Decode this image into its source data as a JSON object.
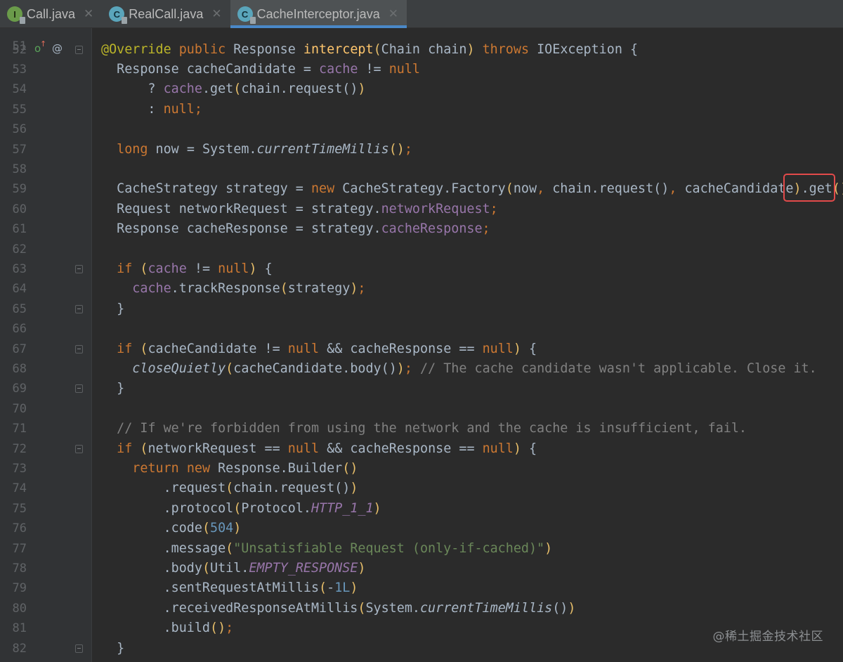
{
  "tabs": [
    {
      "label": "Call.java",
      "icon": "interface-file-icon",
      "icon_letter": "I",
      "active": false,
      "close": "✕"
    },
    {
      "label": "RealCall.java",
      "icon": "class-file-icon",
      "icon_letter": "C",
      "active": false,
      "close": "✕"
    },
    {
      "label": "CacheInterceptor.java",
      "icon": "class-file-icon",
      "icon_letter": "C",
      "active": true,
      "close": "✕"
    }
  ],
  "editor": {
    "first_visible_partial_line": "51",
    "gutter_markers": {
      "line_52": [
        "override-method-icon",
        "annotation-at-icon"
      ],
      "at_sign": "@"
    },
    "highlighted_token": ".get()",
    "lines": [
      {
        "n": "52",
        "t": "@Override public Response intercept(Chain chain) throws IOException {"
      },
      {
        "n": "53",
        "t": "  Response cacheCandidate = cache != null"
      },
      {
        "n": "54",
        "t": "      ? cache.get(chain.request())"
      },
      {
        "n": "55",
        "t": "      : null;"
      },
      {
        "n": "56",
        "t": ""
      },
      {
        "n": "57",
        "t": "  long now = System.currentTimeMillis();"
      },
      {
        "n": "58",
        "t": ""
      },
      {
        "n": "59",
        "t": "  CacheStrategy strategy = new CacheStrategy.Factory(now, chain.request(), cacheCandidate).get();"
      },
      {
        "n": "60",
        "t": "  Request networkRequest = strategy.networkRequest;"
      },
      {
        "n": "61",
        "t": "  Response cacheResponse = strategy.cacheResponse;"
      },
      {
        "n": "62",
        "t": ""
      },
      {
        "n": "63",
        "t": "  if (cache != null) {"
      },
      {
        "n": "64",
        "t": "    cache.trackResponse(strategy);"
      },
      {
        "n": "65",
        "t": "  }"
      },
      {
        "n": "66",
        "t": ""
      },
      {
        "n": "67",
        "t": "  if (cacheCandidate != null && cacheResponse == null) {"
      },
      {
        "n": "68",
        "t": "    closeQuietly(cacheCandidate.body()); // The cache candidate wasn't applicable. Close it."
      },
      {
        "n": "69",
        "t": "  }"
      },
      {
        "n": "70",
        "t": ""
      },
      {
        "n": "71",
        "t": "  // If we're forbidden from using the network and the cache is insufficient, fail."
      },
      {
        "n": "72",
        "t": "  if (networkRequest == null && cacheResponse == null) {"
      },
      {
        "n": "73",
        "t": "    return new Response.Builder()"
      },
      {
        "n": "74",
        "t": "        .request(chain.request())"
      },
      {
        "n": "75",
        "t": "        .protocol(Protocol.HTTP_1_1)"
      },
      {
        "n": "76",
        "t": "        .code(504)"
      },
      {
        "n": "77",
        "t": "        .message(\"Unsatisfiable Request (only-if-cached)\")"
      },
      {
        "n": "78",
        "t": "        .body(Util.EMPTY_RESPONSE)"
      },
      {
        "n": "79",
        "t": "        .sentRequestAtMillis(-1L)"
      },
      {
        "n": "80",
        "t": "        .receivedResponseAtMillis(System.currentTimeMillis())"
      },
      {
        "n": "81",
        "t": "        .build();"
      },
      {
        "n": "82",
        "t": "  }"
      }
    ]
  },
  "watermark": "@稀土掘金技术社区",
  "colors": {
    "background": "#2b2b2b",
    "gutter": "#313335",
    "keyword": "#cc7832",
    "annotation": "#bbb529",
    "method": "#ffc66d",
    "field": "#9876aa",
    "number": "#6897bb",
    "string": "#6a8759",
    "comment": "#808080",
    "text": "#a9b7c6",
    "highlight_box": "#e24a4a",
    "active_tab_underline": "#4a88c7"
  }
}
